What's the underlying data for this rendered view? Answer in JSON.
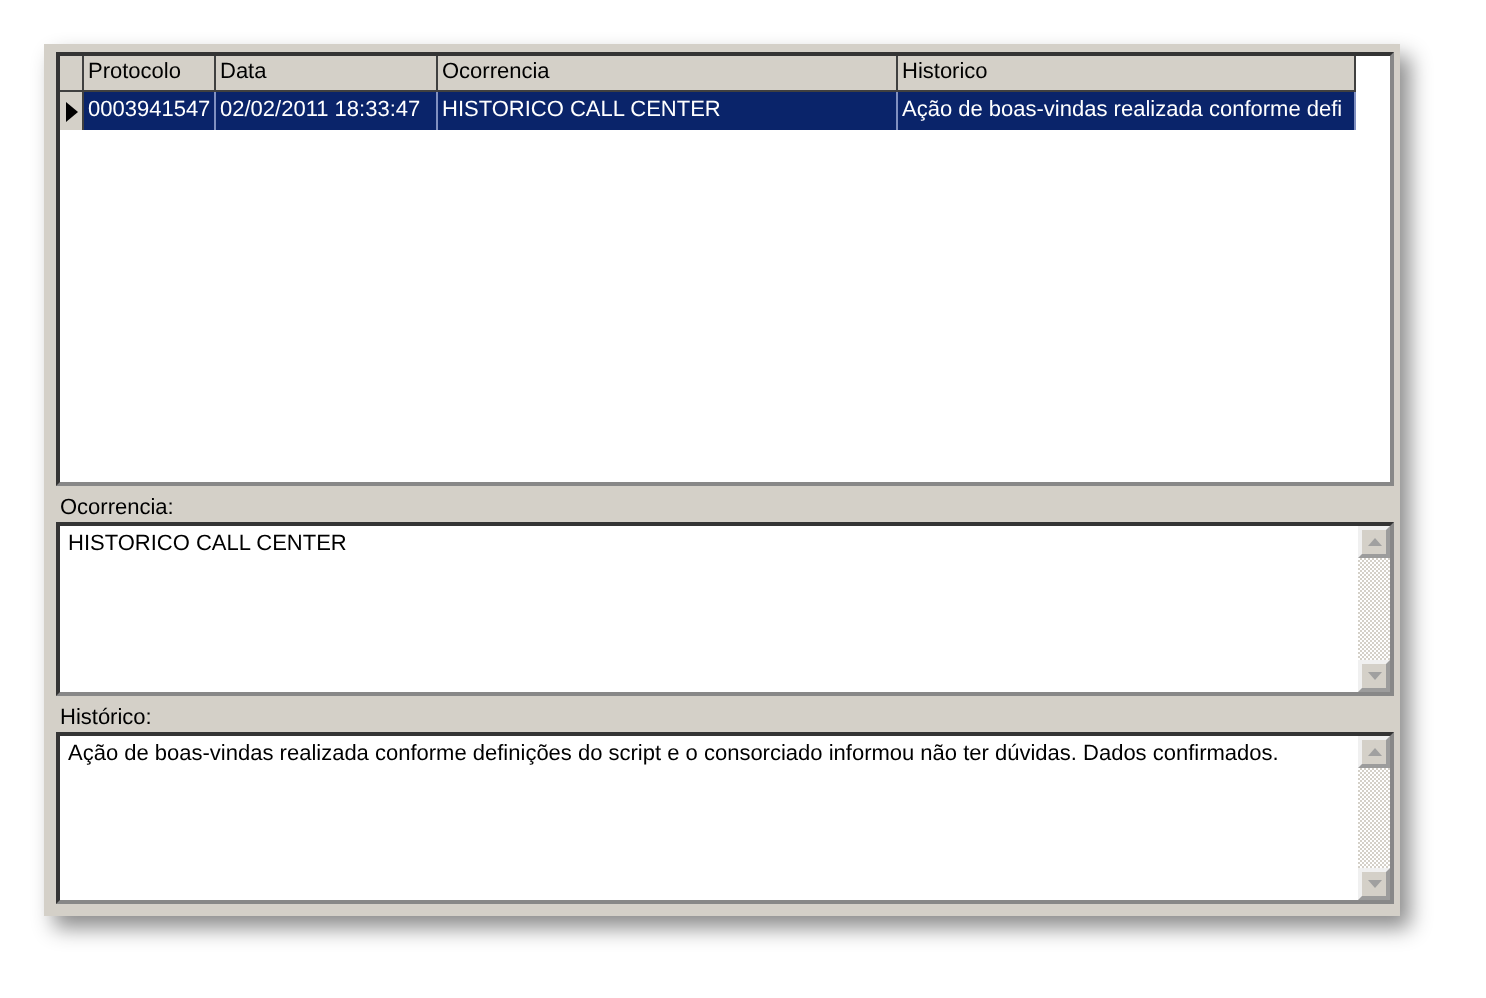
{
  "grid": {
    "columns": [
      "Protocolo",
      "Data",
      "Ocorrencia",
      "Historico"
    ],
    "rows": [
      {
        "selected": true,
        "cells": [
          "0003941547",
          "02/02/2011 18:33:47",
          "HISTORICO CALL CENTER",
          "Ação de boas-vindas realizada conforme defi"
        ]
      }
    ]
  },
  "memos": [
    {
      "label": "Ocorrencia:",
      "value": "HISTORICO CALL CENTER"
    },
    {
      "label": "Histórico:",
      "value": "Ação de boas-vindas realizada conforme definições do script e o consorciado informou não ter dúvidas. Dados confirmados."
    }
  ]
}
